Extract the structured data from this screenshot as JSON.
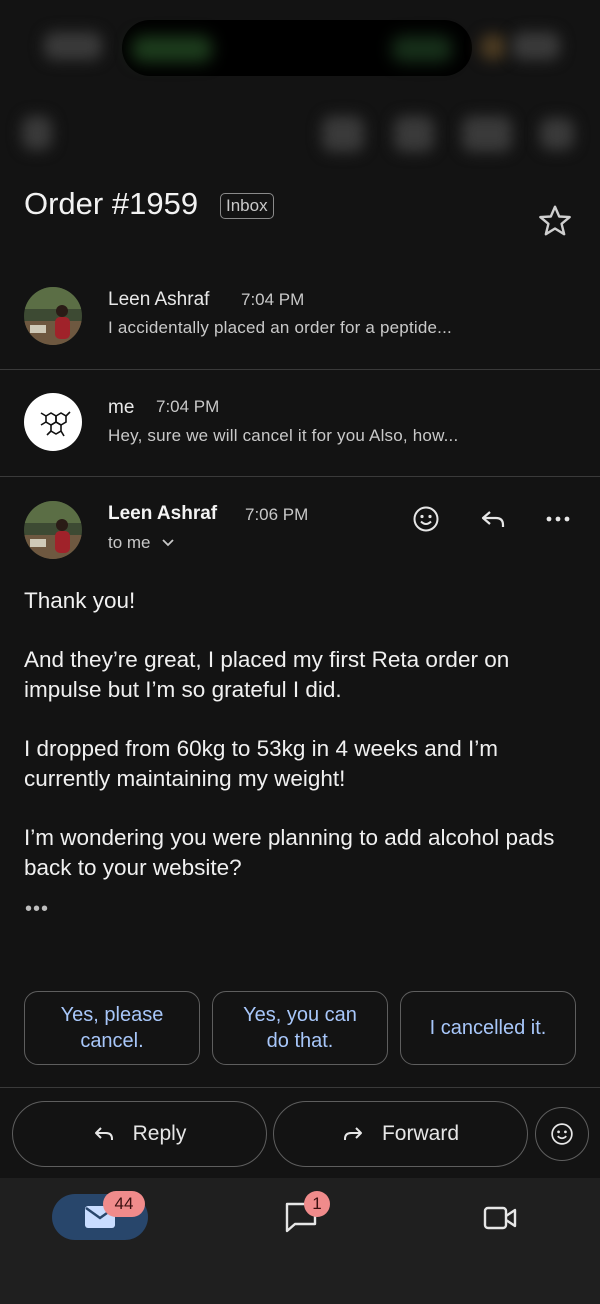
{
  "thread": {
    "subject": "Order #1959",
    "label": "Inbox"
  },
  "messages": [
    {
      "sender": "Leen Ashraf",
      "time": "7:04 PM",
      "snippet": "I accidentally placed an order for a peptide..."
    },
    {
      "sender": "me",
      "time": "7:04 PM",
      "snippet": "Hey, sure we will cancel it for you Also, how..."
    }
  ],
  "open_message": {
    "sender": "Leen Ashraf",
    "time": "7:06 PM",
    "recipient": "to me",
    "body": [
      "Thank you!",
      "And they’re great, I placed my first Reta order on impulse but I’m so grateful I did.",
      "I dropped from 60kg to 53kg in 4 weeks and I’m currently maintaining my weight!",
      "I’m wondering you were planning to add alcohol pads back to your website?"
    ],
    "trimmed": "•••"
  },
  "smart_replies": [
    "Yes, please cancel.",
    "Yes, you can do that.",
    "I cancelled it."
  ],
  "actions": {
    "reply": "Reply",
    "forward": "Forward"
  },
  "nav": {
    "mail_badge": "44",
    "chat_badge": "1"
  },
  "colors": {
    "background": "#131313",
    "accent": "#a8c7fa",
    "mail_pill": "#28466b",
    "badge": "#f08b8b"
  }
}
